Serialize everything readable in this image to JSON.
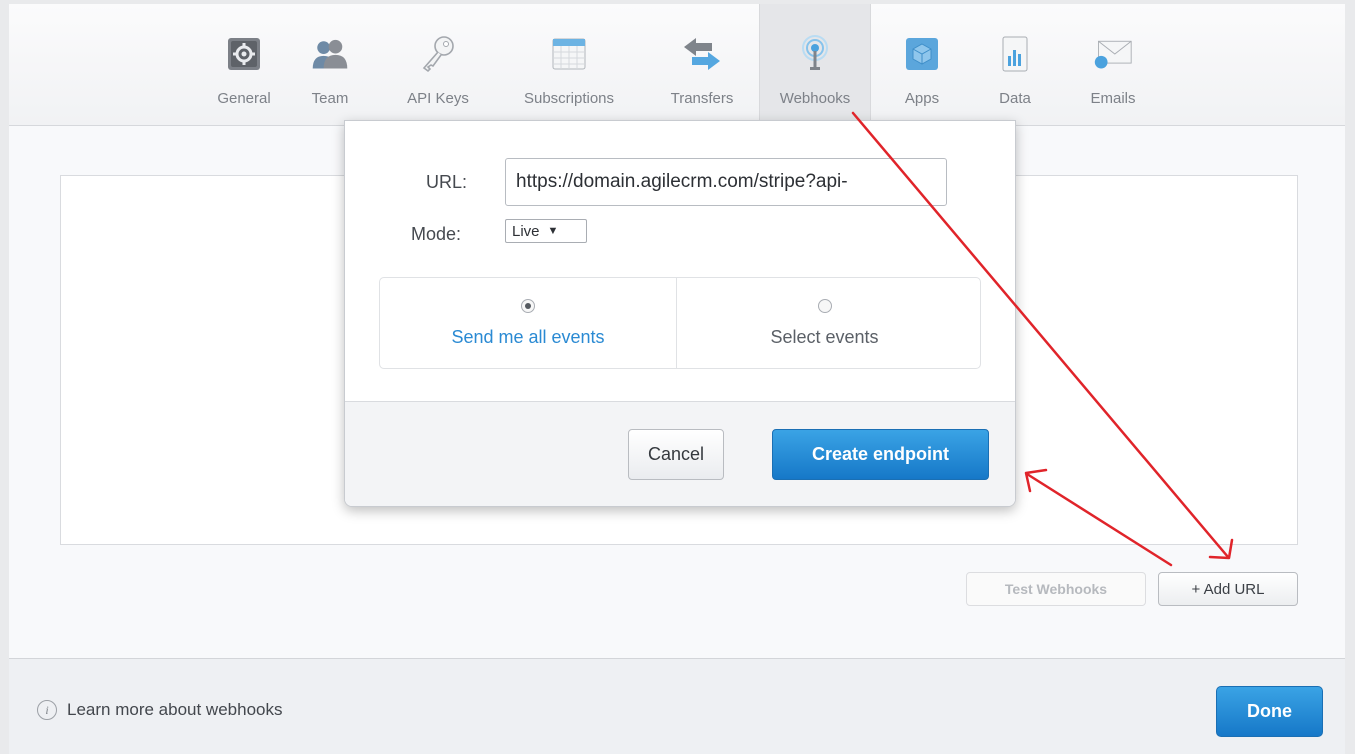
{
  "tabs": [
    {
      "label": "General",
      "icon": "gear-icon"
    },
    {
      "label": "Team",
      "icon": "team-icon"
    },
    {
      "label": "API Keys",
      "icon": "key-icon"
    },
    {
      "label": "Subscriptions",
      "icon": "calendar-icon"
    },
    {
      "label": "Transfers",
      "icon": "transfer-arrows-icon"
    },
    {
      "label": "Webhooks",
      "icon": "webhook-antenna-icon"
    },
    {
      "label": "Apps",
      "icon": "apps-cube-icon"
    },
    {
      "label": "Data",
      "icon": "data-chart-icon"
    },
    {
      "label": "Emails",
      "icon": "email-envelope-icon"
    }
  ],
  "active_tab": "Webhooks",
  "popover": {
    "url_label": "URL:",
    "url_value": "https://domain.agilecrm.com/stripe?api-",
    "mode_label": "Mode:",
    "mode_value": "Live",
    "event_all_label": "Send me all events",
    "event_select_label": "Select events",
    "selected_event_option": "Send me all events",
    "cancel_label": "Cancel",
    "create_label": "Create endpoint"
  },
  "actions": {
    "test_webhooks_label": "Test Webhooks",
    "add_url_label": "+ Add URL"
  },
  "footer": {
    "learn_more_label": "Learn more about webhooks",
    "done_label": "Done"
  },
  "colors": {
    "primary_blue": "#1f86d6",
    "link_blue": "#2a8ad3",
    "annotation_red": "#e0242a"
  }
}
